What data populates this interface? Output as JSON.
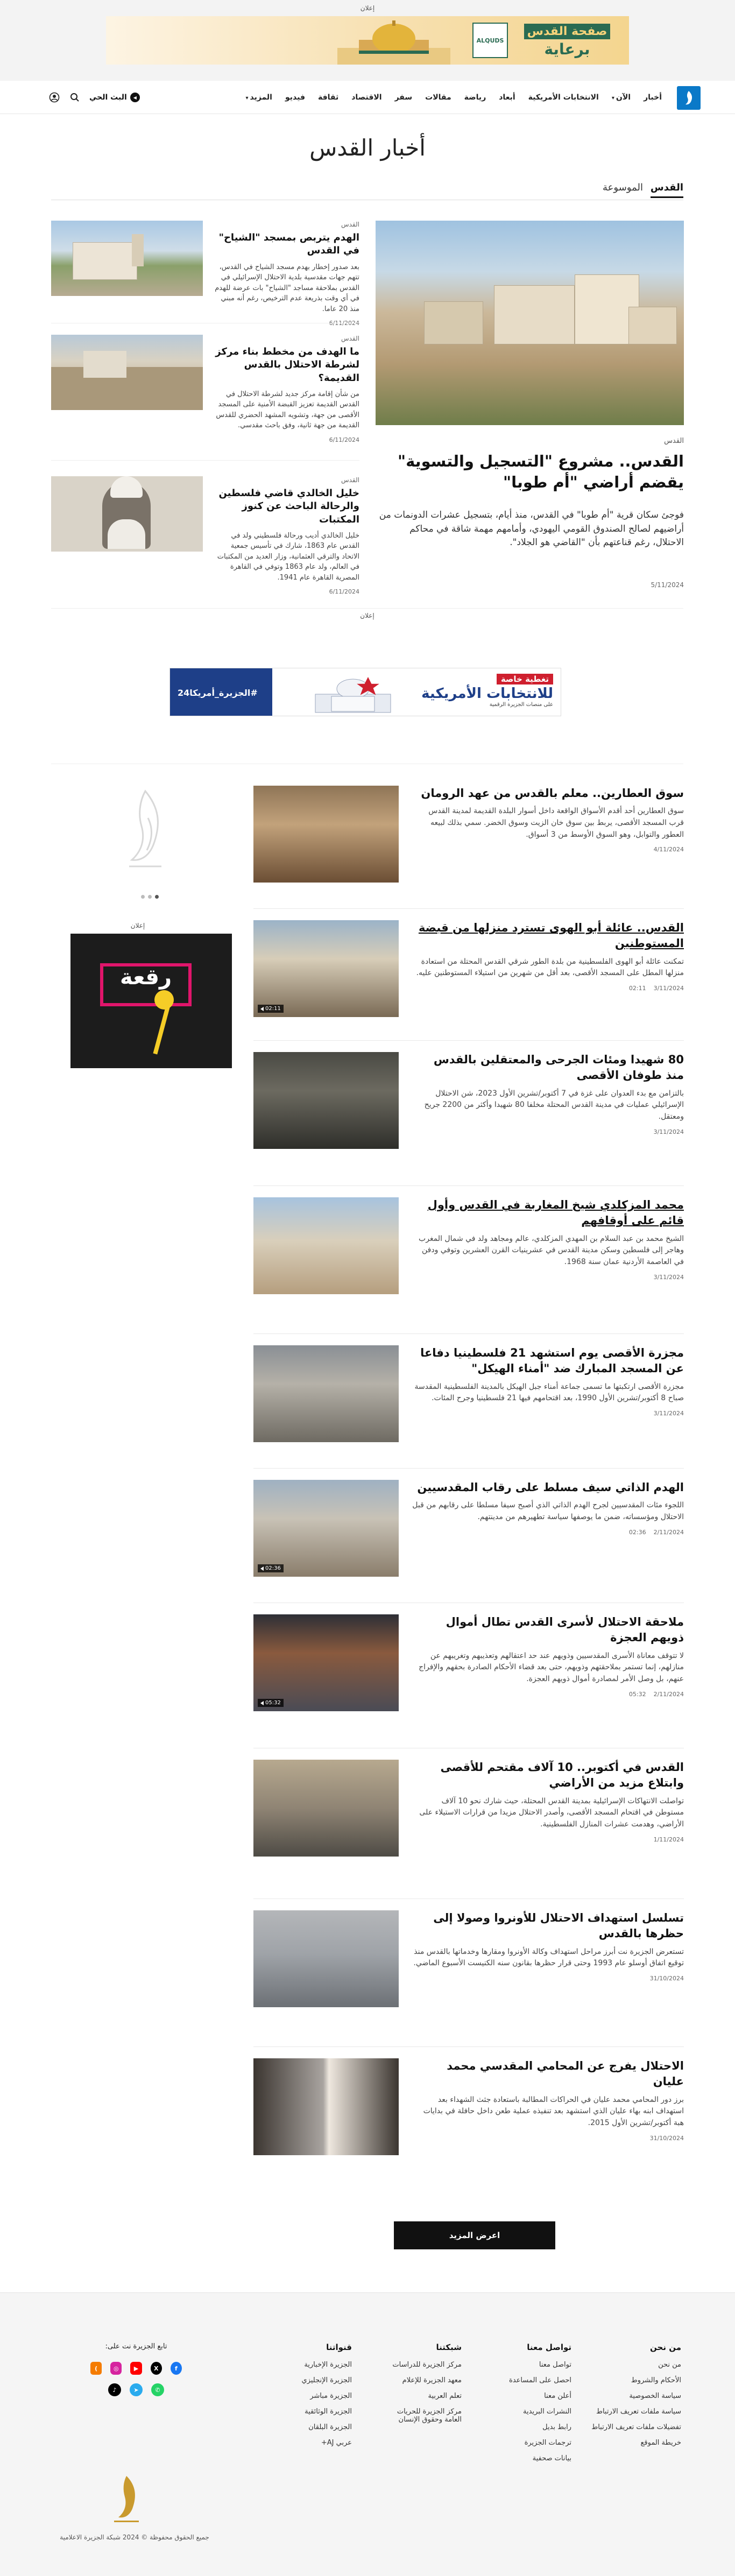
{
  "top_ad": {
    "label": "إعلان",
    "banner_title_a": "صفحة القدس",
    "banner_title_b": "برعاية",
    "logo_text": "ALQUDS"
  },
  "nav": {
    "items": [
      "أخبار",
      "الآن",
      "الانتخابات الأمريكية",
      "أبعاد",
      "رياضة",
      "مقالات",
      "سفر",
      "الاقتصاد",
      "ثقافة",
      "فيديو",
      "المزيد"
    ],
    "live": "البث الحي"
  },
  "page": {
    "title": "أخبار القدس",
    "tabs": [
      "القدس",
      "الموسوعة"
    ]
  },
  "featured": {
    "category": "القدس",
    "title": "القدس.. مشروع \"التسجيل والتسوية\" يقضم أراضي \"أم طوبا\"",
    "excerpt": "فوجئ سكان قرية \"أم طوبا\" في القدس، منذ أيام، بتسجيل عشرات الدونمات من أراضيهم لصالح الصندوق القومي اليهودي، وأمامهم مهمة شاقة في محاكم الاحتلال، رغم قناعتهم بأن \"القاضي هو الجلاد\".",
    "date": "5/11/2024"
  },
  "side_articles": [
    {
      "category": "القدس",
      "title": "الهدم يتربص بمسجد \"الشياح\" في القدس",
      "excerpt": "بعد صدور إخطار بهدم مسجد الشياح في القدس، تتهم جهات مقدسية بلدية الاحتلال الإسرائيلي في القدس بملاحقة مساجد \"الشياح\" بات عرضة للهدم في أي وقت بذريعة عدم الترخيص، رغم أنه مبني منذ 20 عاما.",
      "date": "6/11/2024"
    },
    {
      "category": "القدس",
      "title": "ما الهدف من مخطط بناء مركز لشرطة الاحتلال بالقدس القديمة؟",
      "excerpt": "من شأن إقامة مركز جديد لشرطة الاحتلال في القدس القديمة تعزيز القبضة الأمنية على المسجد الأقصى من جهة، وتشويه المشهد الحضري للقدس القديمة من جهة ثانية، وفق باحث مقدسي.",
      "date": "6/11/2024"
    },
    {
      "category": "القدس",
      "title": "خليل الخالدي قاضي فلسطين والرحالة الباحث عن كنوز المكتبات",
      "excerpt": "خليل الخالدي أديب ورحالة فلسطيني ولد في القدس عام 1863، شارك في تأسيس جمعية الاتحاد والترقي العثمانية، وزار العديد من المكتبات في العالم، ولد عام 1863 وتوفي في القاهرة المصرية القاهرة عام 1941.",
      "date": "6/11/2024"
    }
  ],
  "mid_ad": {
    "label": "إعلان",
    "badge": "تغطية خاصة",
    "title": "للانتخابات الأمريكية",
    "sub": "على منصات الجزيرة الرقمية",
    "tag": "#الجزيرة_أمريكا24"
  },
  "rail": {
    "ad_label": "إعلان",
    "ad_text": "رقعة"
  },
  "articles": [
    {
      "title": "سوق العطارين.. معلم بالقدس من عهد الرومان",
      "excerpt": "سوق العطارين أحد أقدم الأسواق الواقعة داخل أسوار البلدة القديمة لمدينة القدس قرب المسجد الأقصى، يربط بين سوق خان الزيت وسوق الخضر. سمي بذلك لبيعه العطور والتوابل، وهو السوق الأوسط من 3 أسواق.",
      "date": "4/11/2024",
      "time": ""
    },
    {
      "title": "القدس.. عائلة أبو الهوى تسترد منزلها من قبضة المستوطنين",
      "excerpt": "تمكنت عائلة أبو الهوى الفلسطينية من بلدة الطور شرقي القدس المحتلة من استعادة منزلها المطل على المسجد الأقصى، بعد أقل من شهرين من استيلاء المستوطنين عليه.",
      "date": "3/11/2024",
      "time": "02:11"
    },
    {
      "title": "80 شهيدا ومئات الجرحى والمعتقلين بالقدس منذ طوفان الأقصى",
      "excerpt": "بالتزامن مع بدء العدوان على غزة في 7 أكتوبر/تشرين الأول 2023، شن الاحتلال الإسرائيلي عمليات في مدينة القدس المحتلة مخلفا 80 شهيدا وأكثر من 2200 جريح ومعتقل.",
      "date": "3/11/2024",
      "time": ""
    },
    {
      "title": "محمد المزكلدي شيخ المغاربة في القدس وأول قائم على أوقافهم",
      "excerpt": "الشيخ محمد بن عبد السلام بن المهدي المزكلدي، عالم ومجاهد ولد في شمال المغرب وهاجر إلى فلسطين وسكن مدينة القدس في عشرينيات القرن العشرين وتوفي ودفن في العاصمة الأردنية عمان سنة 1968.",
      "date": "3/11/2024",
      "time": ""
    },
    {
      "title": "مجزرة الأقصى يوم استشهد 21 فلسطينيا دفاعا عن المسجد المبارك ضد \"أمناء الهيكل\"",
      "excerpt": "مجزرة الأقصى ارتكبتها ما تسمى جماعة أمناء جبل الهيكل بالمدينة الفلسطينية المقدسة صباح 8 أكتوبر/تشرين الأول 1990، بعد اقتحامهم فيها 21 فلسطينيا وجرح المئات.",
      "date": "3/11/2024",
      "time": ""
    },
    {
      "title": "الهدم الذاتي سيف مسلط على رقاب المقدسيين",
      "excerpt": "اللجوء مئات المقدسيين لجرح الهدم الذاتي الذي أصبح سيفا مسلطا على رقابهم من قبل الاحتلال ومؤسساته، ضمن ما يوصفها سياسة تطهيرهم من مدينتهم.",
      "date": "2/11/2024",
      "time": "02:36"
    },
    {
      "title": "ملاحقة الاحتلال لأسرى القدس تطال أموال ذويهم العجزة",
      "excerpt": "لا تتوقف معاناة الأسرى المقدسيين وذويهم عند حد اعتقالهم وتعذيبهم وتغريبهم عن منازلهم، إنما تستمر بملاحقتهم وذويهم، حتى بعد قضاء الأحكام الصادرة بحقهم والإفراج عنهم، بل وصل الأمر لمصادرة أموال ذويهم العجزة.",
      "date": "2/11/2024",
      "time": "05:32"
    },
    {
      "title": "القدس في أكتوبر.. 10 آلاف مقتحم للأقصى وابتلاع مزيد من الأراضي",
      "excerpt": "تواصلت الانتهاكات الإسرائيلية بمدينة القدس المحتلة، حيث شارك نحو 10 آلاف مستوطن في اقتحام المسجد الأقصى، وأصدر الاحتلال مزيدا من قرارات الاستيلاء على الأراضي، وهدمت عشرات المنازل الفلسطينية.",
      "date": "1/11/2024",
      "time": ""
    },
    {
      "title": "تسلسل استهداف الاحتلال للأونروا وصولا إلى حظرها بالقدس",
      "excerpt": "تستعرض الجزيرة نت أبرز مراحل استهداف وكالة الأونروا ومقارها وخدماتها بالقدس منذ توقيع اتفاق أوسلو عام 1993 وحتى قرار حظرها بقانون سنه الكنيست الأسبوع الماضي.",
      "date": "31/10/2024",
      "time": ""
    },
    {
      "title": "الاحتلال يفرج عن المحامي المقدسي محمد عليان",
      "excerpt": "برز دور المحامي محمد عليان في الحراكات المطالبة باستعادة جثث الشهداء بعد استهداف ابنه بهاء عليان الذي استشهد بعد تنفيذه عملية طعن داخل حافلة في بدايات هبة أكتوبر/تشرين الأول 2015.",
      "date": "31/10/2024",
      "time": ""
    }
  ],
  "more_button": "اعرض المزيد",
  "footer": {
    "columns": [
      {
        "head": "من نحن",
        "links": [
          "من نحن",
          "الأحكام والشروط",
          "سياسة الخصوصية",
          "سياسة ملفات تعريف الارتباط",
          "تفضيلات ملفات تعريف الارتباط",
          "خريطة الموقع"
        ]
      },
      {
        "head": "تواصل معنا",
        "links": [
          "تواصل معنا",
          "احصل على المساعدة",
          "أعلن معنا",
          "النشرات البريدية",
          "رابط بديل",
          "ترجمات الجزيرة",
          "بيانات صحفية"
        ]
      },
      {
        "head": "شبكتنا",
        "links": [
          "مركز الجزيرة للدراسات",
          "معهد الجزيرة للإعلام",
          "تعلم العربية",
          "مركز الجزيرة للحريات العامة وحقوق الإنسان"
        ]
      },
      {
        "head": "قنواتنا",
        "links": [
          "الجزيرة الإخبارية",
          "الجزيرة الإنجليزي",
          "الجزيرة مباشر",
          "الجزيرة الوثائقية",
          "الجزيرة البلقان",
          "عربي AJ+"
        ]
      }
    ],
    "follow": "تابع الجزيرة نت على:",
    "copyright": "جميع الحقوق محفوظة © 2024 شبكة الجزيرة الاعلامية"
  },
  "colors": {
    "brand": "#0a79c8",
    "ink": "#111111"
  }
}
